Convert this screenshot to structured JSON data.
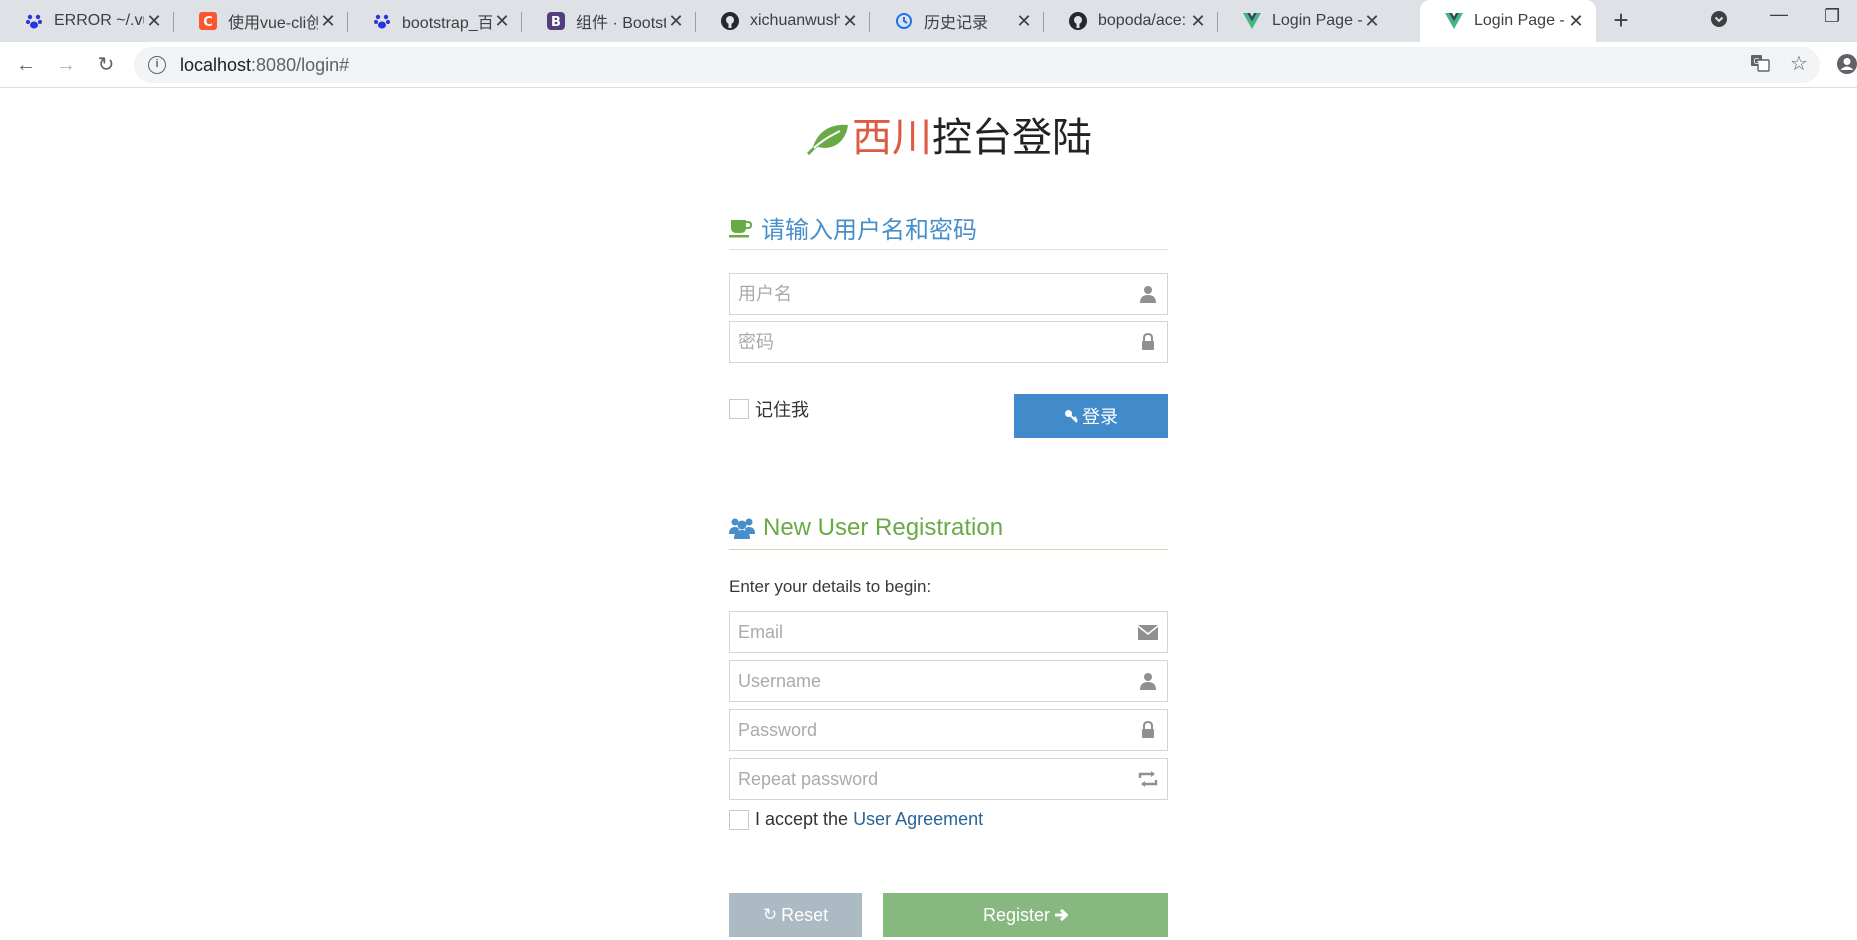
{
  "browser": {
    "tabs": [
      {
        "title": "ERROR ~/.vue",
        "icon": "baidu-icon"
      },
      {
        "title": "使用vue-cli创",
        "icon": "csdn-icon"
      },
      {
        "title": "bootstrap_百",
        "icon": "baidu-icon"
      },
      {
        "title": "组件 · Bootstr",
        "icon": "bootstrap-icon"
      },
      {
        "title": "xichuanwush",
        "icon": "github-icon"
      },
      {
        "title": "历史记录",
        "icon": "history-icon"
      },
      {
        "title": "bopoda/ace:",
        "icon": "github-icon"
      },
      {
        "title": "Login Page -",
        "icon": "vue-icon"
      },
      {
        "title": "Login Page -",
        "icon": "vue-icon",
        "active": true
      }
    ],
    "url_host": "localhost",
    "url_rest": ":8080/login#"
  },
  "page": {
    "brand_red": "西川",
    "brand_dark": "控台登陆",
    "login": {
      "header": "请输入用户名和密码",
      "username_placeholder": "用户名",
      "password_placeholder": "密码",
      "remember_label": "记住我",
      "login_button": "登录"
    },
    "register": {
      "header": "New User Registration",
      "lead": "Enter your details to begin:",
      "email_placeholder": "Email",
      "username_placeholder": "Username",
      "password_placeholder": "Password",
      "repeat_placeholder": "Repeat password",
      "accept_prefix": "I accept the",
      "agreement_link": "User Agreement",
      "reset_button": "Reset",
      "register_button": "Register"
    }
  },
  "colors": {
    "brand_red": "#dd5a43",
    "login_header": "#478fca",
    "register_header": "#69aa46",
    "login_button": "#428bca",
    "reset_button": "#abbac3",
    "register_button": "#87b87f",
    "link": "#2a6496"
  }
}
